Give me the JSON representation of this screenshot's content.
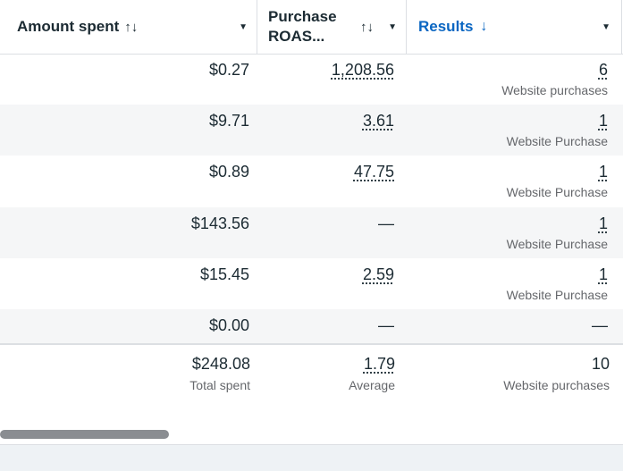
{
  "header": {
    "amount_label": "Amount spent",
    "amount_sort_icon": "↑↓",
    "roas_label_line1": "Purchase",
    "roas_label_line2": "ROAS...",
    "roas_sort_icon": "↑↓",
    "results_label": "Results",
    "results_sort_icon": "↓",
    "caret": "▼",
    "results_color": "#0a66c2"
  },
  "rows": [
    {
      "amount": "$0.27",
      "roas": "1,208.56",
      "result": "6",
      "result_type": "Website purchases"
    },
    {
      "amount": "$9.71",
      "roas": "3.61",
      "result": "1",
      "result_type": "Website Purchase"
    },
    {
      "amount": "$0.89",
      "roas": "47.75",
      "result": "1",
      "result_type": "Website Purchase"
    },
    {
      "amount": "$143.56",
      "roas": "—",
      "result": "1",
      "result_type": "Website Purchase"
    },
    {
      "amount": "$15.45",
      "roas": "2.59",
      "result": "1",
      "result_type": "Website Purchase"
    },
    {
      "amount": "$0.00",
      "roas": "—",
      "result": "—",
      "result_type": ""
    }
  ],
  "totals": {
    "amount": "$248.08",
    "amount_label": "Total spent",
    "roas": "1.79",
    "roas_label": "Average",
    "result": "10",
    "result_label": "Website purchases"
  }
}
